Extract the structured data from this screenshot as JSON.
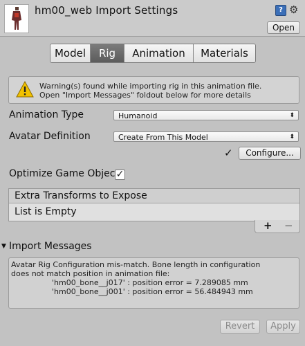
{
  "header": {
    "title": "hm00_web Import Settings",
    "open_label": "Open",
    "help_icon": "help-icon",
    "gear_icon": "gear-icon"
  },
  "tabs": [
    {
      "label": "Model",
      "active": false
    },
    {
      "label": "Rig",
      "active": true
    },
    {
      "label": "Animation",
      "active": false
    },
    {
      "label": "Materials",
      "active": false
    }
  ],
  "warning": {
    "line1": "Warning(s) found while importing rig in this animation file.",
    "line2": "Open \"Import Messages\" foldout below for more details",
    "icon": "warning-icon"
  },
  "animation_type": {
    "label": "Animation Type",
    "value": "Humanoid"
  },
  "avatar_definition": {
    "label": "Avatar Definition",
    "value": "Create From This Model"
  },
  "configure": {
    "check": "✓",
    "label": "Configure..."
  },
  "optimize": {
    "label": "Optimize Game Objec",
    "checked": true
  },
  "extra_transforms": {
    "header": "Extra Transforms to Expose",
    "empty_text": "List is Empty",
    "plus": "+",
    "minus": "−"
  },
  "import_messages": {
    "label": "Import Messages",
    "lines": [
      "Avatar Rig Configuration mis-match. Bone length in configuration",
      "does not match position in animation file:",
      "'hm00_bone__j017' : position error = 7.289085 mm",
      "'hm00_bone__j001' : position error = 56.484943 mm"
    ]
  },
  "buttons": {
    "revert": "Revert",
    "apply": "Apply"
  },
  "colors": {
    "active_tab": "#6a6a6a",
    "help_icon": "#3b6fb8",
    "warning": "#f2c200"
  }
}
